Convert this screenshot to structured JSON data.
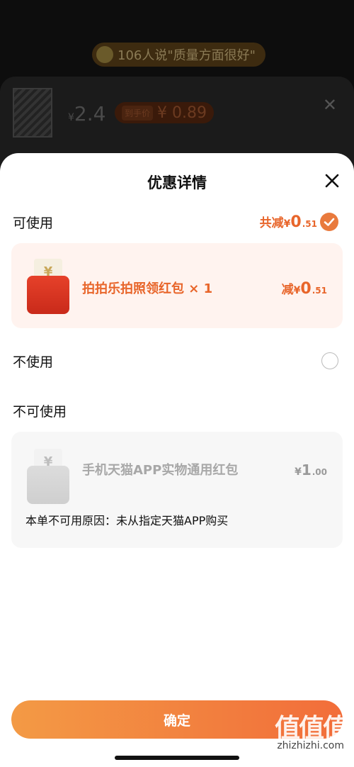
{
  "background": {
    "banner_text": "106人说\"质量方面很好\"",
    "price_symbol": "¥",
    "price_value": "2.4",
    "pill_tag": "到手价",
    "pill_price": "¥ 0.89",
    "close_glyph": "✕"
  },
  "sheet": {
    "title": "优惠详情",
    "sections": {
      "usable": "可使用",
      "not_use": "不使用",
      "unusable": "不可使用"
    },
    "total": {
      "prefix": "共减",
      "currency": "¥",
      "integer": "0",
      "decimal": ".51"
    },
    "usable_coupon": {
      "name": "拍拍乐拍照领红包 × 1",
      "reduce_prefix": "减",
      "currency": "¥",
      "integer": "0",
      "decimal": ".51",
      "envelope_glyph": "¥"
    },
    "unusable_coupon": {
      "name": "手机天猫APP实物通用红包",
      "currency": "¥",
      "integer": "1",
      "decimal": ".00",
      "reason": "本单不可用原因：未从指定天猫APP购买",
      "envelope_glyph": "¥"
    },
    "confirm_label": "确定"
  },
  "watermark": {
    "text": "值值值",
    "url": "zhizhizhi.com"
  },
  "colors": {
    "accent": "#e8652a",
    "button_start": "#f39a45",
    "button_end": "#f26d3a",
    "usable_card_bg": "#fff3ef",
    "unusable_card_bg": "#f7f7f7"
  }
}
